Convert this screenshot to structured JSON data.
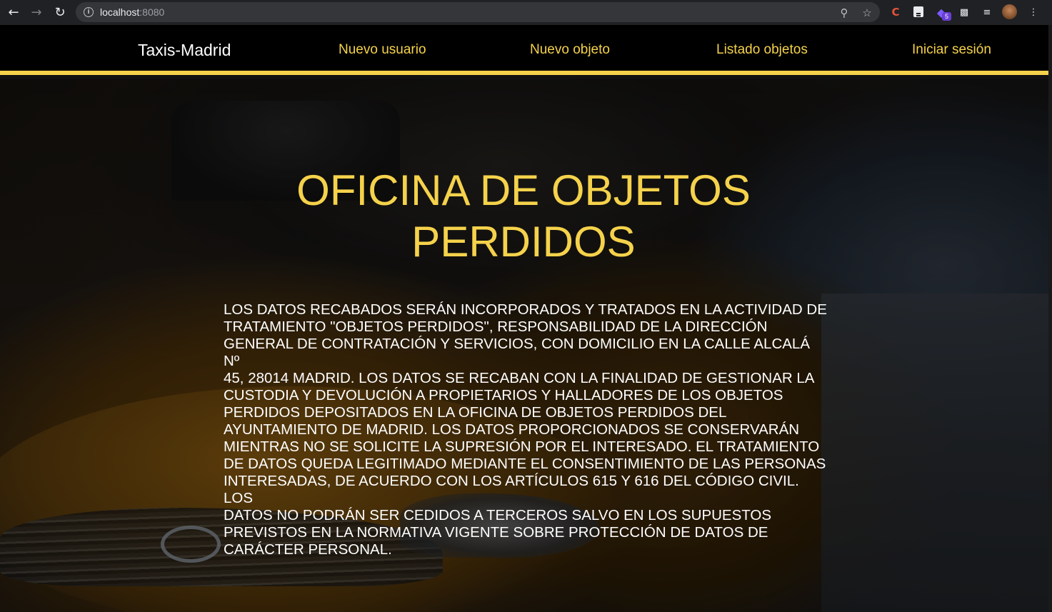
{
  "browser": {
    "url_host": "localhost",
    "url_port": ":8080",
    "extension_badge": "5",
    "icons": [
      "back-arrow-icon",
      "forward-arrow-icon",
      "reload-icon",
      "site-info-icon",
      "zoom-icon",
      "bookmark-star-icon",
      "extensions-puzzle-icon",
      "media-queue-icon",
      "menu-kebab-icon"
    ]
  },
  "navbar": {
    "brand": "Taxis-Madrid",
    "links": [
      "Nuevo usuario",
      "Nuevo objeto",
      "Listado objetos",
      "Iniciar sesión"
    ],
    "accent_color": "#f5d24b",
    "background_color": "#000000"
  },
  "main": {
    "title_line1": "OFICINA DE OBJETOS",
    "title_line2": "PERDIDOS",
    "notice_lines": [
      "LOS DATOS RECABADOS SERÁN INCORPORADOS Y TRATADOS EN LA ACTIVIDAD DE",
      "TRATAMIENTO \"OBJETOS PERDIDOS\", RESPONSABILIDAD DE LA DIRECCIÓN",
      "GENERAL DE CONTRATACIÓN Y SERVICIOS, CON DOMICILIO EN LA CALLE ALCALÁ Nº",
      "45, 28014 MADRID. LOS DATOS SE RECABAN CON LA FINALIDAD DE GESTIONAR LA",
      "CUSTODIA Y DEVOLUCIÓN A PROPIETARIOS Y HALLADORES DE LOS OBJETOS",
      "PERDIDOS DEPOSITADOS EN LA OFICINA DE OBJETOS PERDIDOS DEL",
      "AYUNTAMIENTO DE MADRID. LOS DATOS PROPORCIONADOS SE CONSERVARÁN",
      "MIENTRAS NO SE SOLICITE LA SUPRESIÓN POR EL INTERESADO. EL TRATAMIENTO",
      "DE DATOS QUEDA LEGITIMADO MEDIANTE EL CONSENTIMIENTO DE LAS PERSONAS",
      "INTERESADAS, DE ACUERDO CON LOS ARTÍCULOS 615 Y 616 DEL CÓDIGO CIVIL. LOS",
      "DATOS NO PODRÁN SER CEDIDOS A TERCEROS SALVO EN LOS SUPUESTOS",
      "PREVISTOS EN LA NORMATIVA VIGENTE SOBRE PROTECCIÓN DE DATOS DE",
      "CARÁCTER PERSONAL."
    ],
    "title_color": "#f5d24b"
  }
}
